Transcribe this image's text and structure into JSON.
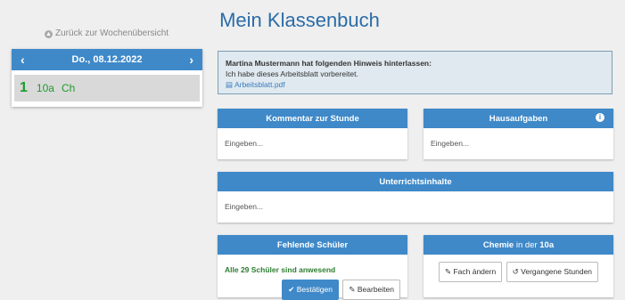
{
  "page": {
    "title": "Mein Klassenbuch",
    "back_link": "Zurück zur Wochenübersicht"
  },
  "day": {
    "date": "Do., 08.12.2022",
    "prev_icon": "chevron-left-icon",
    "next_icon": "chevron-right-icon"
  },
  "lesson": {
    "number": "1",
    "class": "10a",
    "subject": "Ch"
  },
  "notice": {
    "head": "Martina Mustermann hat folgenden Hinweis hinterlassen:",
    "text": "Ich habe dieses Arbeitsblatt vorbereitet.",
    "file": "Arbeitsblatt.pdf"
  },
  "comment": {
    "title": "Kommentar zur Stunde",
    "placeholder": "Eingeben..."
  },
  "homework": {
    "title": "Hausaufgaben",
    "placeholder": "Eingeben..."
  },
  "content": {
    "title": "Unterrichtsinhalte",
    "placeholder": "Eingeben..."
  },
  "missing": {
    "title": "Fehlende Schüler",
    "status": "Alle 29 Schüler sind anwesend",
    "confirm": "Bestätigen",
    "edit": "Bearbeiten"
  },
  "subject_panel": {
    "subject": "Chemie",
    "in_the": "in der",
    "class": "10a",
    "change": "Fach ändern",
    "past": "Vergangene Stunden"
  },
  "colors": {
    "accent": "#3f89c9",
    "title": "#2b6ca8",
    "present": "#1e9b2a"
  }
}
